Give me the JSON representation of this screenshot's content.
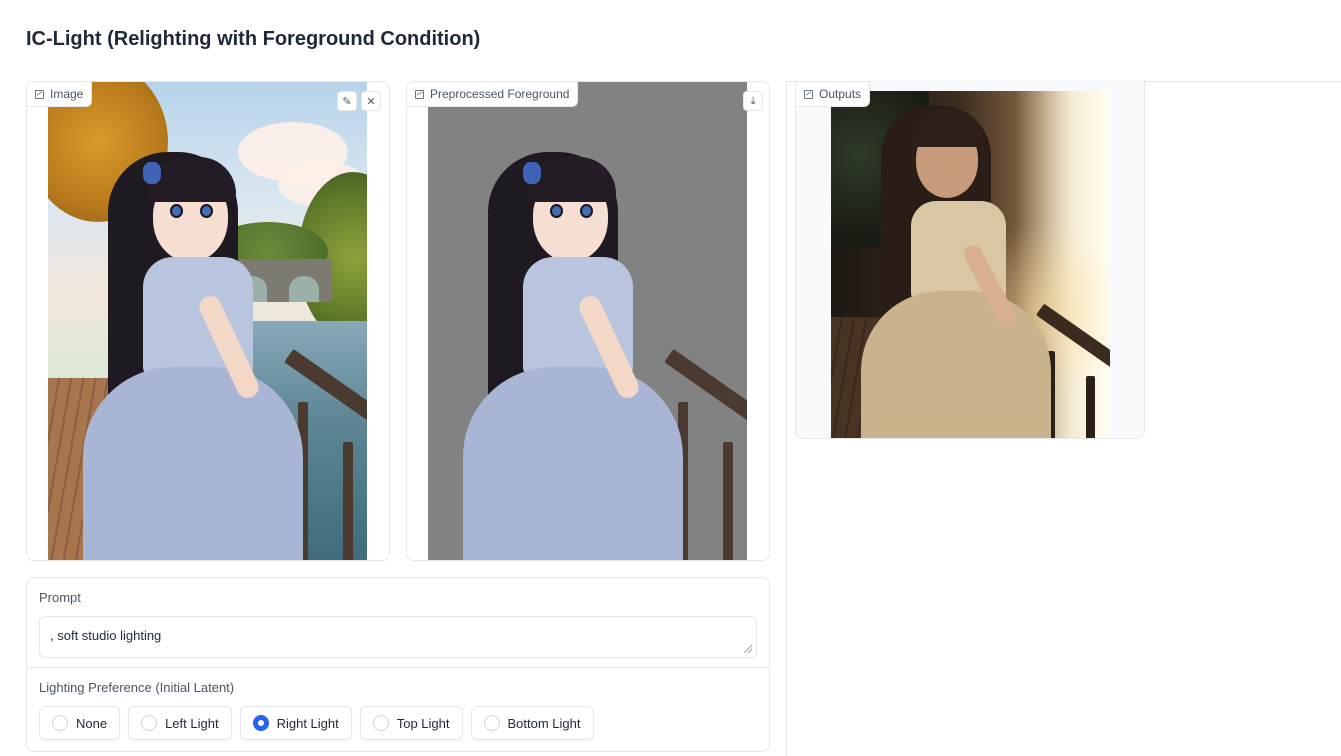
{
  "page": {
    "title": "IC-Light (Relighting with Foreground Condition)"
  },
  "image_panel": {
    "label": "Image",
    "label_icon": "image-icon",
    "tools": [
      "edit-icon",
      "close-icon"
    ]
  },
  "preprocessed_panel": {
    "label": "Preprocessed Foreground",
    "label_icon": "image-icon",
    "tools": [
      "download-icon"
    ]
  },
  "outputs_panel": {
    "label": "Outputs",
    "label_icon": "image-icon"
  },
  "prompt": {
    "label": "Prompt",
    "value": ", soft studio lighting"
  },
  "lighting": {
    "label": "Lighting Preference (Initial Latent)",
    "options": [
      "None",
      "Left Light",
      "Right Light",
      "Top Light",
      "Bottom Light"
    ],
    "selected": "Right Light"
  },
  "colors": {
    "accent": "#2563eb",
    "border": "#e5e7eb",
    "text": "#1f2937"
  }
}
